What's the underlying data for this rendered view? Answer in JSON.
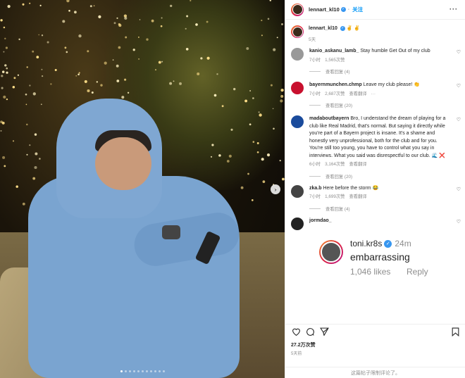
{
  "header": {
    "username": "lennart_kl10",
    "follow_label": "关注",
    "more_label": "···"
  },
  "caption": {
    "username": "lennart_kl10",
    "text": "✌ ✌",
    "time": "5天"
  },
  "comments": [
    {
      "username": "kanio_askanu_lamb_",
      "text": "Stay humble Get Out of my club",
      "time": "7小时",
      "likes": "1,565次赞",
      "reply": "",
      "view_replies": "查看回复 (4)"
    },
    {
      "username": "bayernmunchen.chmp",
      "text": "Leave my club please! 👏",
      "time": "7小时",
      "likes": "2,687次赞",
      "reply": "查看翻译",
      "more": "···",
      "view_replies": "查看回复 (20)"
    },
    {
      "username": "madaboutbayern",
      "text": "Bro, I understand the dream of playing for a club like Real Madrid, that's normal. But saying it directly while you're part of a Bayern project is insane. It's a shame and honestly very unprofessional, both for the club and for you. You're still too young, you have to control what you say in interviews. What you said was disrespectful to our club. 🌊 ❌",
      "time": "6小时",
      "likes": "3,164次赞",
      "reply": "查看翻译",
      "view_replies": "查看回复 (20)"
    },
    {
      "username": "zka.b",
      "text": "Here before the storm 😂",
      "time": "7小时",
      "likes": "1,699次赞",
      "reply": "查看翻译",
      "view_replies": "查看回复 (4)"
    },
    {
      "username": "jormdao_",
      "text": "",
      "time": "",
      "likes": "",
      "reply": "",
      "view_replies": ""
    }
  ],
  "quote": {
    "username": "toni.kr8s",
    "time": "24m",
    "text": "embarrassing",
    "likes": "1,046 likes",
    "reply": "Reply"
  },
  "footer": {
    "likes": "27.2万次赞",
    "ago": "5天前",
    "comments_disabled": "这篇帖子限制评论了。"
  },
  "carousel": {
    "count": 11,
    "active_index": 0
  },
  "colors": {
    "accent": "#0095f6",
    "verified": "#3897f0",
    "muted": "#8e8e8e"
  }
}
